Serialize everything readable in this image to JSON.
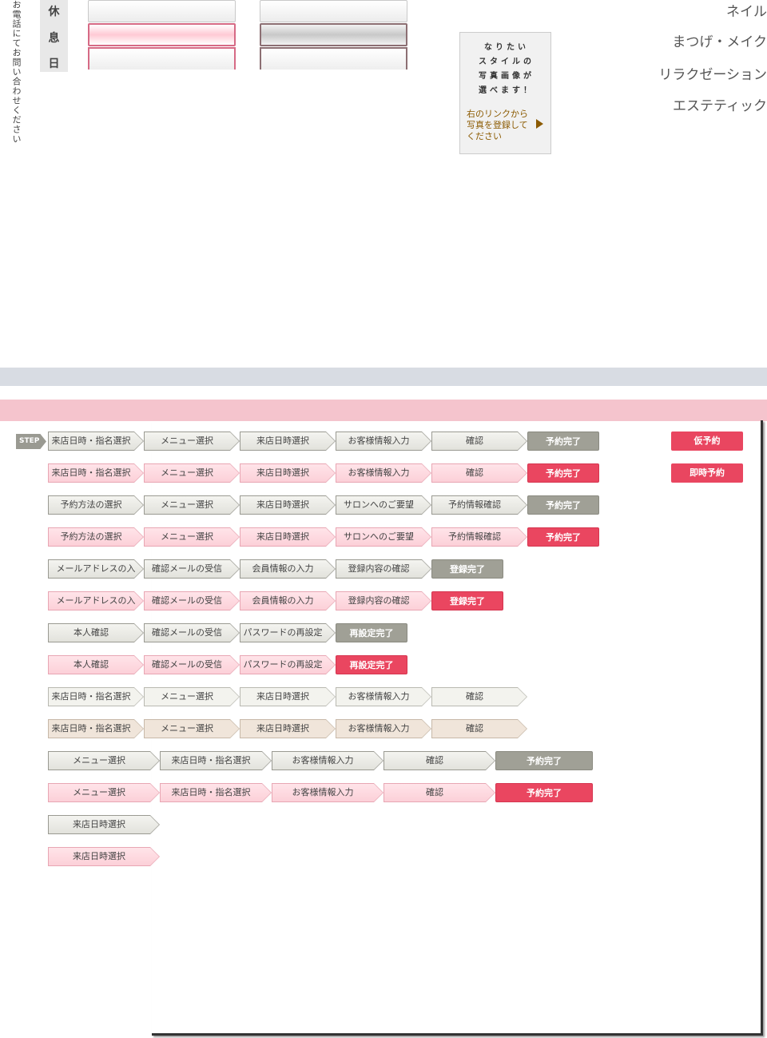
{
  "vertical_notice": "お電話にてお問い合わせください",
  "closed_days": {
    "chars": [
      "休",
      "息",
      "日"
    ]
  },
  "photo_box": {
    "heading_lines": [
      "なりたい",
      "スタイルの",
      "写真画像が",
      "選べます！"
    ],
    "link_text": "右のリンクから写真を登録してください"
  },
  "categories": [
    "ネイル",
    "まつげ・メイク",
    "リラクゼーション",
    "エステティック"
  ],
  "colors": {
    "gray_band": "#d8dce3",
    "pink_band": "#f5c4cd",
    "accent_red": "#ea4660",
    "finish_gray": "#a0a096",
    "link_brown": "#8b5a00"
  },
  "step_label": "STEP",
  "reserve_buttons": [
    "仮予約",
    "即時予約"
  ],
  "step_rows": [
    {
      "steps": [
        "来店日時・指名選択",
        "メニュー選択",
        "来店日時選択",
        "お客様情報入力",
        "確認"
      ],
      "final": "予約完了"
    },
    {
      "steps": [
        "来店日時・指名選択",
        "メニュー選択",
        "来店日時選択",
        "お客様情報入力",
        "確認"
      ],
      "final": "予約完了"
    },
    {
      "steps": [
        "予約方法の選択",
        "メニュー選択",
        "来店日時選択",
        "サロンへのご要望",
        "予約情報確認"
      ],
      "final": "予約完了"
    },
    {
      "steps": [
        "予約方法の選択",
        "メニュー選択",
        "来店日時選択",
        "サロンへのご要望",
        "予約情報確認"
      ],
      "final": "予約完了"
    },
    {
      "steps": [
        "メールアドレスの入力",
        "確認メールの受信",
        "会員情報の入力",
        "登録内容の確認"
      ],
      "final": "登録完了"
    },
    {
      "steps": [
        "メールアドレスの入力",
        "確認メールの受信",
        "会員情報の入力",
        "登録内容の確認"
      ],
      "final": "登録完了"
    },
    {
      "steps": [
        "本人確認",
        "確認メールの受信",
        "パスワードの再設定"
      ],
      "final": "再設定完了"
    },
    {
      "steps": [
        "本人確認",
        "確認メールの受信",
        "パスワードの再設定"
      ],
      "final": "再設定完了"
    },
    {
      "steps": [
        "来店日時・指名選択",
        "メニュー選択",
        "来店日時選択",
        "お客様情報入力",
        "確認"
      ],
      "final": ""
    },
    {
      "steps": [
        "来店日時・指名選択",
        "メニュー選択",
        "来店日時選択",
        "お客様情報入力",
        "確認"
      ],
      "final": ""
    },
    {
      "steps": [
        "メニュー選択",
        "来店日時・指名選択",
        "お客様情報入力",
        "確認"
      ],
      "final": "予約完了"
    },
    {
      "steps": [
        "メニュー選択",
        "来店日時・指名選択",
        "お客様情報入力",
        "確認"
      ],
      "final": "予約完了"
    },
    {
      "steps": [
        "来店日時選択"
      ],
      "final": ""
    },
    {
      "steps": [
        "来店日時選択"
      ],
      "final": ""
    }
  ]
}
